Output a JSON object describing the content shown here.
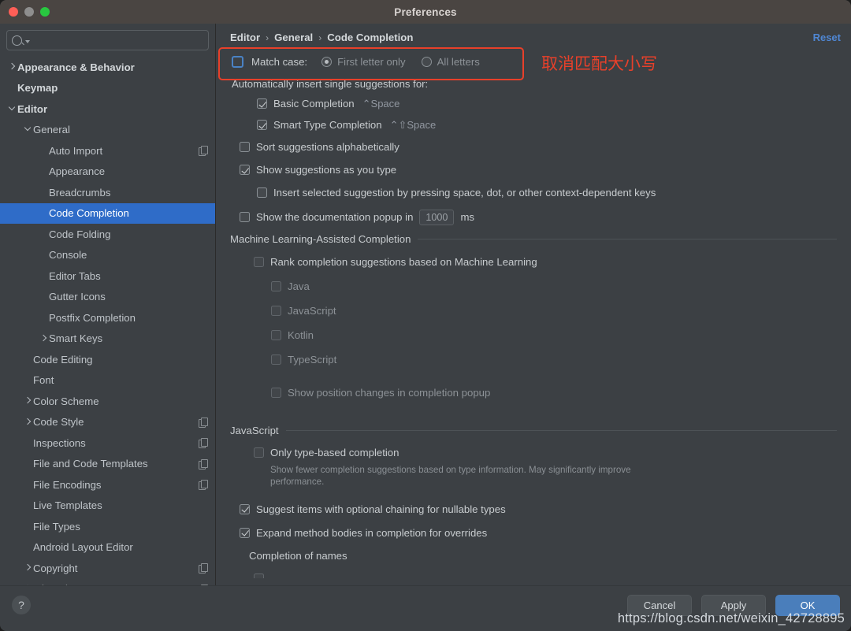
{
  "window": {
    "title": "Preferences",
    "traffic": [
      "close",
      "minimize",
      "maximize"
    ]
  },
  "search": {
    "value": "",
    "placeholder": ""
  },
  "sidebar": {
    "items": [
      {
        "label": "Appearance & Behavior",
        "indent": 0,
        "arrow": "right",
        "bold": true,
        "copy": false,
        "selected": false
      },
      {
        "label": "Keymap",
        "indent": 0,
        "arrow": "none",
        "bold": true,
        "copy": false,
        "selected": false
      },
      {
        "label": "Editor",
        "indent": 0,
        "arrow": "down",
        "bold": true,
        "copy": false,
        "selected": false
      },
      {
        "label": "General",
        "indent": 1,
        "arrow": "down",
        "bold": false,
        "copy": false,
        "selected": false
      },
      {
        "label": "Auto Import",
        "indent": 2,
        "arrow": "none",
        "bold": false,
        "copy": true,
        "selected": false
      },
      {
        "label": "Appearance",
        "indent": 2,
        "arrow": "none",
        "bold": false,
        "copy": false,
        "selected": false
      },
      {
        "label": "Breadcrumbs",
        "indent": 2,
        "arrow": "none",
        "bold": false,
        "copy": false,
        "selected": false
      },
      {
        "label": "Code Completion",
        "indent": 2,
        "arrow": "none",
        "bold": false,
        "copy": false,
        "selected": true
      },
      {
        "label": "Code Folding",
        "indent": 2,
        "arrow": "none",
        "bold": false,
        "copy": false,
        "selected": false
      },
      {
        "label": "Console",
        "indent": 2,
        "arrow": "none",
        "bold": false,
        "copy": false,
        "selected": false
      },
      {
        "label": "Editor Tabs",
        "indent": 2,
        "arrow": "none",
        "bold": false,
        "copy": false,
        "selected": false
      },
      {
        "label": "Gutter Icons",
        "indent": 2,
        "arrow": "none",
        "bold": false,
        "copy": false,
        "selected": false
      },
      {
        "label": "Postfix Completion",
        "indent": 2,
        "arrow": "none",
        "bold": false,
        "copy": false,
        "selected": false
      },
      {
        "label": "Smart Keys",
        "indent": 2,
        "arrow": "right",
        "bold": false,
        "copy": false,
        "selected": false
      },
      {
        "label": "Code Editing",
        "indent": 1,
        "arrow": "none",
        "bold": false,
        "copy": false,
        "selected": false
      },
      {
        "label": "Font",
        "indent": 1,
        "arrow": "none",
        "bold": false,
        "copy": false,
        "selected": false
      },
      {
        "label": "Color Scheme",
        "indent": 1,
        "arrow": "right",
        "bold": false,
        "copy": false,
        "selected": false
      },
      {
        "label": "Code Style",
        "indent": 1,
        "arrow": "right",
        "bold": false,
        "copy": true,
        "selected": false
      },
      {
        "label": "Inspections",
        "indent": 1,
        "arrow": "none",
        "bold": false,
        "copy": true,
        "selected": false
      },
      {
        "label": "File and Code Templates",
        "indent": 1,
        "arrow": "none",
        "bold": false,
        "copy": true,
        "selected": false
      },
      {
        "label": "File Encodings",
        "indent": 1,
        "arrow": "none",
        "bold": false,
        "copy": true,
        "selected": false
      },
      {
        "label": "Live Templates",
        "indent": 1,
        "arrow": "none",
        "bold": false,
        "copy": false,
        "selected": false
      },
      {
        "label": "File Types",
        "indent": 1,
        "arrow": "none",
        "bold": false,
        "copy": false,
        "selected": false
      },
      {
        "label": "Android Layout Editor",
        "indent": 1,
        "arrow": "none",
        "bold": false,
        "copy": false,
        "selected": false
      },
      {
        "label": "Copyright",
        "indent": 1,
        "arrow": "right",
        "bold": false,
        "copy": true,
        "selected": false
      },
      {
        "label": "Inlay Hints",
        "indent": 1,
        "arrow": "right",
        "bold": false,
        "copy": true,
        "selected": false
      }
    ]
  },
  "breadcrumb": {
    "parts": [
      "Editor",
      "General",
      "Code Completion"
    ],
    "separator": "›"
  },
  "reset_label": "Reset",
  "settings": {
    "match_case": {
      "label": "Match case:",
      "checked": false,
      "options": [
        {
          "label": "First letter only",
          "selected": true
        },
        {
          "label": "All letters",
          "selected": false
        }
      ]
    },
    "auto_insert_header": "Automatically insert single suggestions for:",
    "auto_insert_items": [
      {
        "label": "Basic Completion",
        "shortcut": "⌃Space",
        "checked": true
      },
      {
        "label": "Smart Type Completion",
        "shortcut": "⌃⇧Space",
        "checked": true
      }
    ],
    "sort_alphabetically": {
      "label": "Sort suggestions alphabetically",
      "checked": false
    },
    "show_as_you_type": {
      "label": "Show suggestions as you type",
      "checked": true
    },
    "insert_selected": {
      "label": "Insert selected suggestion by pressing space, dot, or other context-dependent keys",
      "checked": false
    },
    "doc_popup": {
      "label": "Show the documentation popup in",
      "value": "1000",
      "unit": "ms",
      "checked": false
    },
    "ml_section": {
      "title": "Machine Learning-Assisted Completion",
      "rank": {
        "label": "Rank completion suggestions based on Machine Learning",
        "checked": false
      },
      "languages": [
        {
          "label": "Java",
          "checked": false
        },
        {
          "label": "JavaScript",
          "checked": false
        },
        {
          "label": "Kotlin",
          "checked": false
        },
        {
          "label": "TypeScript",
          "checked": false
        }
      ],
      "position_changes": {
        "label": "Show position changes in completion popup",
        "checked": false
      }
    },
    "javascript_section": {
      "title": "JavaScript",
      "only_type_based": {
        "label": "Only type-based completion",
        "checked": false,
        "hint": "Show fewer completion suggestions based on type information. May significantly improve performance."
      },
      "optional_chaining": {
        "label": "Suggest items with optional chaining for nullable types",
        "checked": true
      },
      "expand_method_bodies": {
        "label": "Expand method bodies in completion for overrides",
        "checked": true
      },
      "completion_of_names": "Completion of names"
    }
  },
  "annotation": {
    "text": "取消匹配大小写",
    "color": "#e8402a"
  },
  "footer": {
    "help": "?",
    "buttons": [
      {
        "label": "Cancel",
        "primary": false
      },
      {
        "label": "Apply",
        "primary": false
      },
      {
        "label": "OK",
        "primary": true
      }
    ]
  },
  "watermark": "https://blog.csdn.net/weixin_42728895",
  "colors": {
    "accent": "#2f6cc8",
    "link": "#4f87d4",
    "annotation": "#e8402a",
    "panel_bg": "#3c4044",
    "titlebar_bg": "#4a4542"
  }
}
